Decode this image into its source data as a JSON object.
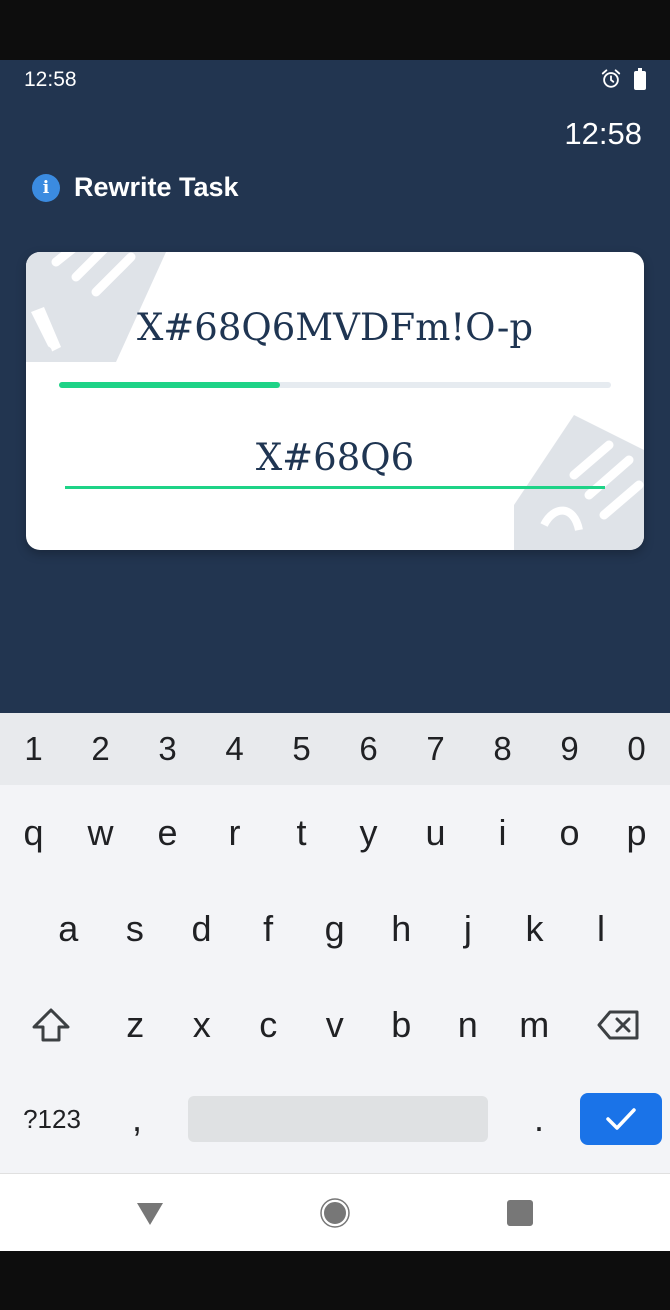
{
  "status_bar": {
    "time": "12:58",
    "icons": [
      "alarm-icon",
      "battery-icon"
    ]
  },
  "header": {
    "clock": "12:58",
    "title": "Rewrite Task",
    "title_icon": "info-icon",
    "info_glyph": "i"
  },
  "task": {
    "target_text": "X#68Q6MVDFm!O-p",
    "input_value": "X#68Q6",
    "progress": 0.4
  },
  "keyboard": {
    "number_row": [
      "1",
      "2",
      "3",
      "4",
      "5",
      "6",
      "7",
      "8",
      "9",
      "0"
    ],
    "row1": [
      "q",
      "w",
      "e",
      "r",
      "t",
      "y",
      "u",
      "i",
      "o",
      "p"
    ],
    "row2": [
      "a",
      "s",
      "d",
      "f",
      "g",
      "h",
      "j",
      "k",
      "l"
    ],
    "row3": [
      "z",
      "x",
      "c",
      "v",
      "b",
      "n",
      "m"
    ],
    "symbols_label": "?123",
    "comma": ",",
    "period": "."
  },
  "colors": {
    "app_background": "#223550",
    "accent_green": "#1ed387",
    "enter_blue": "#1a73e8",
    "info_blue": "#3b8be0"
  }
}
